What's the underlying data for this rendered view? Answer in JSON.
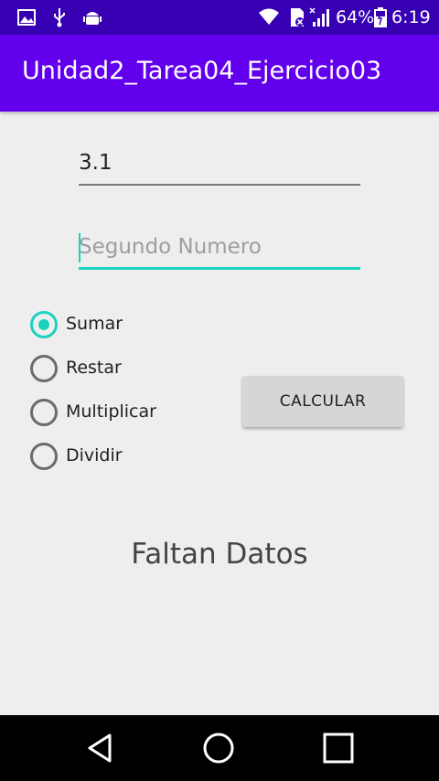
{
  "status_bar": {
    "battery_percent": "64%",
    "time": "6:19",
    "left_icons": [
      "image-icon",
      "usb-icon",
      "android-debug-icon"
    ],
    "right_icons": [
      "wifi-icon",
      "sim-icon",
      "signal-icon",
      "battery-icon"
    ]
  },
  "app_bar": {
    "title": "Unidad2_Tarea04_Ejercicio03",
    "color": "#6200ee",
    "status_color": "#3700b3"
  },
  "form": {
    "first_number": {
      "value": "3.1"
    },
    "second_number": {
      "value": "",
      "placeholder": "Segundo Numero"
    },
    "accent_color": "#1bd1c0",
    "operations": [
      {
        "label": "Sumar",
        "checked": true
      },
      {
        "label": "Restar",
        "checked": false
      },
      {
        "label": "Multiplicar",
        "checked": false
      },
      {
        "label": "Dividir",
        "checked": false
      }
    ],
    "calculate_label": "CALCULAR"
  },
  "result": {
    "text": "Faltan Datos"
  },
  "nav_bar": {
    "buttons": [
      "back-icon",
      "home-icon",
      "recents-icon"
    ]
  }
}
